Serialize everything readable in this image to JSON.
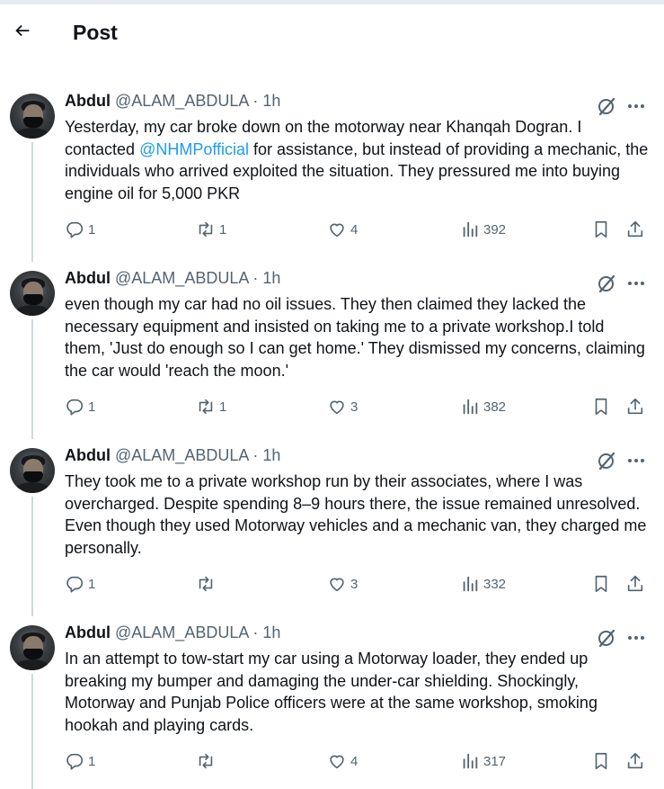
{
  "header": {
    "title": "Post"
  },
  "tweets": [
    {
      "name": "Abdul",
      "handle": "@ALAM_ABDULA",
      "dot": "·",
      "time": "1h",
      "text_before": "Yesterday, my car broke down on the motorway near Khanqah Dogran. I contacted ",
      "mention": "@NHMPofficial",
      "text_after": " for assistance, but instead of providing a mechanic, the individuals who arrived exploited the situation. They pressured me into buying engine oil for 5,000 PKR",
      "replies": "1",
      "reposts": "1",
      "likes": "4",
      "views": "392"
    },
    {
      "name": "Abdul",
      "handle": "@ALAM_ABDULA",
      "dot": "·",
      "time": "1h",
      "text_before": "even though my car had no oil issues. They then claimed they lacked the necessary equipment and insisted on taking me to a private workshop.I told them, 'Just do enough so I can get home.' They dismissed my concerns, claiming the car would 'reach the moon.'",
      "mention": "",
      "text_after": "",
      "replies": "1",
      "reposts": "1",
      "likes": "3",
      "views": "382"
    },
    {
      "name": "Abdul",
      "handle": "@ALAM_ABDULA",
      "dot": "·",
      "time": "1h",
      "text_before": "They took me to a private workshop run by their associates, where I was overcharged. Despite spending 8–9 hours there, the issue remained unresolved. Even though they used Motorway vehicles and a mechanic van, they charged me personally.",
      "mention": "",
      "text_after": "",
      "replies": "1",
      "reposts": "",
      "likes": "3",
      "views": "332"
    },
    {
      "name": "Abdul",
      "handle": "@ALAM_ABDULA",
      "dot": "·",
      "time": "1h",
      "text_before": "In an attempt to tow-start my car using a Motorway loader, they ended up breaking my bumper and damaging the under-car shielding. Shockingly, Motorway and Punjab Police officers were at the same workshop, smoking hookah and playing cards.",
      "mention": "",
      "text_after": "",
      "replies": "1",
      "reposts": "",
      "likes": "4",
      "views": "317"
    }
  ],
  "icons": {
    "back": "arrow-left-icon",
    "grok": "grok-icon",
    "more": "more-icon",
    "reply": "reply-icon",
    "repost": "repost-icon",
    "like": "heart-icon",
    "views": "views-icon",
    "bookmark": "bookmark-icon",
    "share": "share-icon"
  },
  "colors": {
    "accent": "#1d9bf0",
    "text": "#0f1419",
    "muted": "#536471",
    "thread_line": "#cfd9de"
  }
}
